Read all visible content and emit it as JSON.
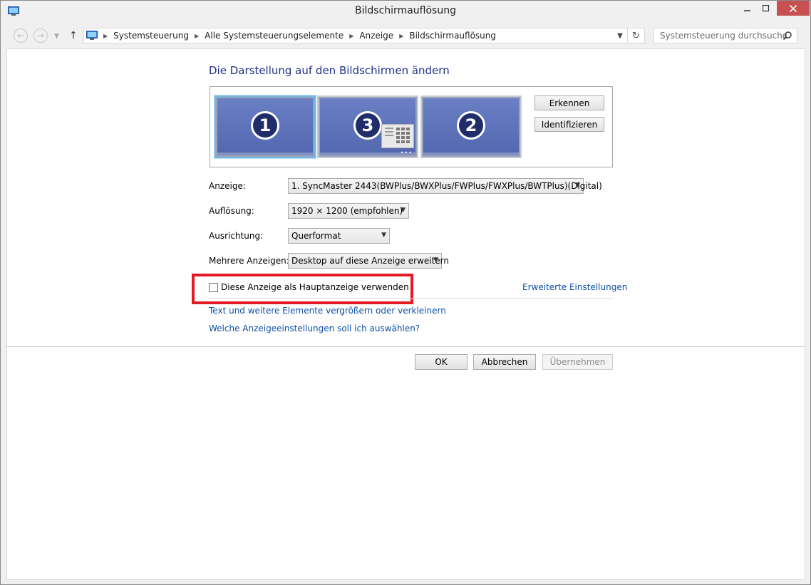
{
  "window": {
    "title": "Bildschirmauflösung",
    "controls": {
      "minimize": "–",
      "maximize": "□",
      "close": "✕"
    }
  },
  "navigation": {
    "breadcrumbs": [
      "Systemsteuerung",
      "Alle Systemsteuerungselemente",
      "Anzeige",
      "Bildschirmauflösung"
    ],
    "search_placeholder": "Systemsteuerung durchsuchen"
  },
  "main": {
    "heading": "Die Darstellung auf den Bildschirmen ändern",
    "monitors": [
      {
        "number": "1",
        "selected": true
      },
      {
        "number": "3",
        "selected": false
      },
      {
        "number": "2",
        "selected": false
      }
    ],
    "buttons": {
      "detect": "Erkennen",
      "identify": "Identifizieren"
    },
    "fields": {
      "display": {
        "label": "Anzeige:",
        "value": "1. SyncMaster 2443(BWPlus/BWXPlus/FWPlus/FWXPlus/BWTPlus)(Digital)"
      },
      "resolution": {
        "label": "Auflösung:",
        "value": "1920 × 1200 (empfohlen)"
      },
      "orientation": {
        "label": "Ausrichtung:",
        "value": "Querformat"
      },
      "multiple": {
        "label": "Mehrere Anzeigen:",
        "value": "Desktop auf diese Anzeige erweitern"
      }
    },
    "main_display_checkbox": {
      "label": "Diese Anzeige als Hauptanzeige verwenden",
      "checked": false
    },
    "advanced_link": "Erweiterte Einstellungen",
    "links": [
      "Text und weitere Elemente vergrößern oder verkleinern",
      "Welche Anzeigeeinstellungen soll ich auswählen?"
    ]
  },
  "dialog_buttons": {
    "ok": "OK",
    "cancel": "Abbrechen",
    "apply": "Übernehmen"
  },
  "colors": {
    "heading": "#1e3287",
    "link": "#0b4fa8",
    "highlight_box": "#e21a24",
    "close_button": "#c75050"
  }
}
